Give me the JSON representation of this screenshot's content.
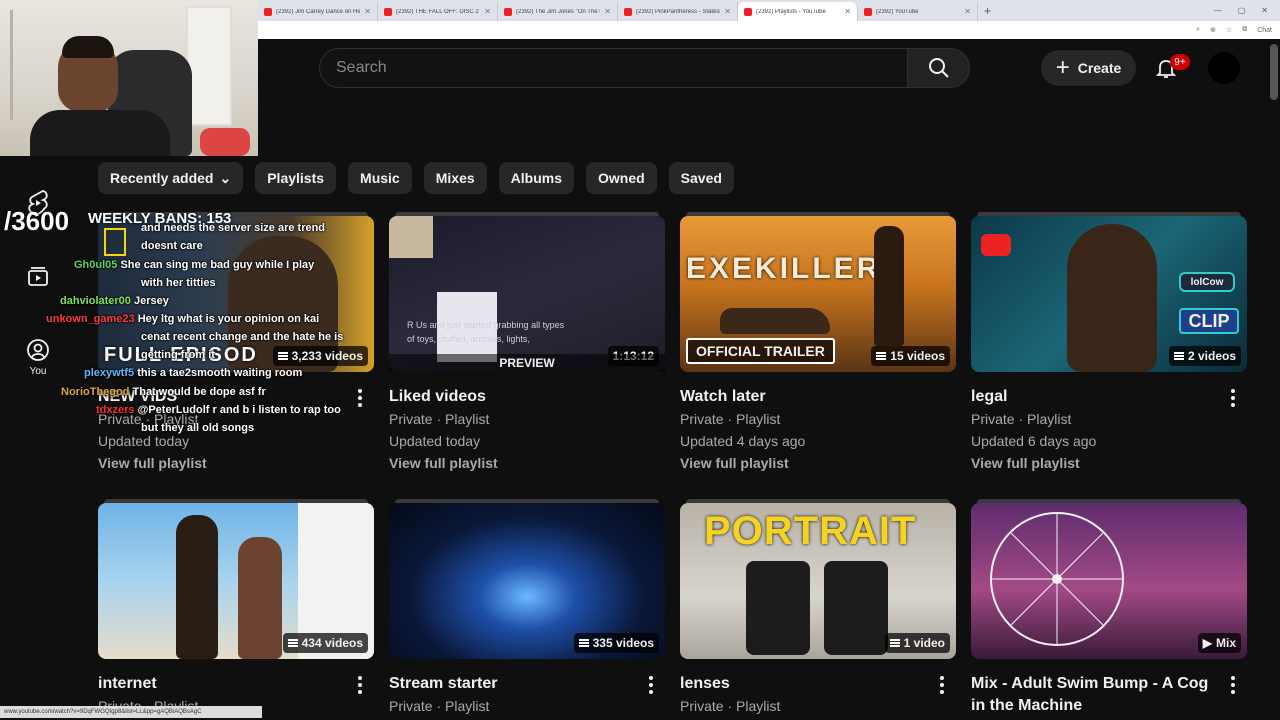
{
  "browser": {
    "tabs": [
      {
        "label": "(2392) Jim Carrey Dance on Hey F...",
        "active": false
      },
      {
        "label": "(2392) THE FALL OFF: DISC 2 TRA...",
        "active": false
      },
      {
        "label": "(2392) The Jim Jones \"On The Rad...",
        "active": false
      },
      {
        "label": "(2392) PinkPantheress - Stateside",
        "active": false
      },
      {
        "label": "(2392) Playlists - YouTube",
        "active": true
      },
      {
        "label": "(2392) YouTube",
        "active": false
      }
    ],
    "new_tab": "+",
    "chat_label": "Chat",
    "status_url": "www.youtube.com/watch?v=9DqFWGQtgp8&list=LL&pp=gAQBiAQBsAgC"
  },
  "header": {
    "search_placeholder": "Search",
    "create_label": "Create",
    "notif_badge": "9+"
  },
  "sidebar": {
    "items": [
      {
        "label": "Shorts",
        "icon": "shorts-icon"
      },
      {
        "label": "Subscriptions",
        "icon": "subscriptions-icon"
      },
      {
        "label": "You",
        "icon": "you-icon"
      }
    ]
  },
  "filters": [
    "Recently added",
    "Playlists",
    "Music",
    "Mixes",
    "Albums",
    "Owned",
    "Saved"
  ],
  "overlay": {
    "counter": "/3600",
    "weekly_bans": "WEEKLY BANS: 153",
    "thumb_title": "FULL EPISOD",
    "preview_label": "PREVIEW",
    "duration": "1:13:12",
    "thumb_text_1": "R Us and just started grabbing all types",
    "thumb_text_2": "of toys, stuffed, animals, lights,",
    "trailer_badge": "OFFICIAL TRAILER",
    "exekiller_title": "EXEKILLER",
    "portrait_title": "PORTRAIT",
    "thumb_badge_1": "lolCow",
    "thumb_badge_2": "CLIP"
  },
  "chat": [
    {
      "user": "",
      "text": "and needs the server size are trend"
    },
    {
      "user": "",
      "text": "doesnt care"
    },
    {
      "user": "Gh0ul05",
      "text": "She can sing me bad guy while I play"
    },
    {
      "user": "",
      "text": "with her titties"
    },
    {
      "user": "dahviolater00",
      "text": "Jersey"
    },
    {
      "user": "unkown_game23",
      "text": "Hey ltg what is your opinion on kai"
    },
    {
      "user": "",
      "text": "cenat recent change and the hate he is"
    },
    {
      "user": "",
      "text": "getting from it"
    },
    {
      "user": "plexywtf5",
      "text": "this a tae2smooth waiting room"
    },
    {
      "user": "NorioThegod",
      "text": "That would be dope asf fr"
    },
    {
      "user": "tdxzers",
      "text": "@PeterLudolf r and b i listen to rap too"
    },
    {
      "user": "",
      "text": "but they all old songs"
    }
  ],
  "playlists": [
    {
      "title": "NEW VIDS",
      "meta": "Private · Playlist",
      "updated": "Updated today",
      "view": "View full playlist",
      "count": "3,233 videos",
      "has_menu": true
    },
    {
      "title": "Liked videos",
      "meta": "Private · Playlist",
      "updated": "Updated today",
      "view": "View full playlist",
      "count": "",
      "has_menu": false
    },
    {
      "title": "Watch later",
      "meta": "Private · Playlist",
      "updated": "Updated 4 days ago",
      "view": "View full playlist",
      "count": "15 videos",
      "has_menu": false
    },
    {
      "title": "legal",
      "meta": "Private · Playlist",
      "updated": "Updated 6 days ago",
      "view": "View full playlist",
      "count": "2 videos",
      "has_menu": true
    },
    {
      "title": "internet",
      "meta": "Private · Playlist",
      "updated": "",
      "view": "",
      "count": "434 videos",
      "has_menu": true
    },
    {
      "title": "Stream starter",
      "meta": "Private · Playlist",
      "updated": "",
      "view": "",
      "count": "335 videos",
      "has_menu": true
    },
    {
      "title": "lenses",
      "meta": "Private · Playlist",
      "updated": "",
      "view": "",
      "count": "1 video",
      "has_menu": true
    },
    {
      "title": "Mix - Adult Swim Bump - A Cog in the Machine",
      "meta": "",
      "updated": "",
      "view": "",
      "count": "Mix",
      "has_menu": true
    }
  ],
  "colors": {
    "background": "#0f0f0f",
    "chip": "#272727",
    "badge": "#cc0000",
    "secondary_text": "#aaaaaa"
  }
}
